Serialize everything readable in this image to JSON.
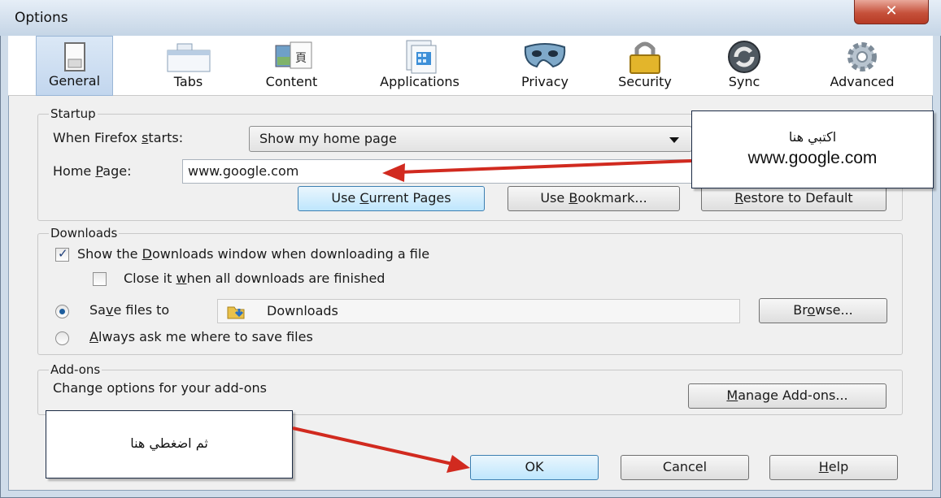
{
  "window": {
    "title": "Options",
    "close_glyph": "✕"
  },
  "toolbar": {
    "tabs": [
      {
        "label": "General",
        "icon": "switch-icon",
        "selected": true
      },
      {
        "label": "Tabs",
        "icon": "tabs-icon"
      },
      {
        "label": "Content",
        "icon": "content-icon"
      },
      {
        "label": "Applications",
        "icon": "applications-icon"
      },
      {
        "label": "Privacy",
        "icon": "mask-icon"
      },
      {
        "label": "Security",
        "icon": "padlock-icon"
      },
      {
        "label": "Sync",
        "icon": "sync-icon"
      },
      {
        "label": "Advanced",
        "icon": "gear-icon"
      }
    ]
  },
  "startup": {
    "group_label": "Startup",
    "when_starts_label": "When Firefox starts:",
    "when_starts_value": "Show my home page",
    "home_page_label": "Home Page:",
    "home_page_value": "www.google.com",
    "use_current_pages": "Use Current Pages",
    "use_bookmark": "Use Bookmark...",
    "restore_default": "Restore to Default"
  },
  "downloads": {
    "group_label": "Downloads",
    "show_window_label": "Show the Downloads window when downloading a file",
    "show_window_checked": true,
    "close_it_label": "Close it when all downloads are finished",
    "close_it_checked": false,
    "save_files_label": "Save files to",
    "save_folder": "Downloads",
    "browse": "Browse...",
    "always_ask_label": "Always ask me where to save files"
  },
  "addons": {
    "group_label": "Add-ons",
    "description": "Change options for your add-ons",
    "manage": "Manage Add-ons..."
  },
  "footer": {
    "ok": "OK",
    "cancel": "Cancel",
    "help": "Help"
  },
  "annotations": {
    "homepage_callout_line1": "اكتبي هنا",
    "homepage_callout_line2": "www.google.com",
    "ok_callout": "ثم اضغطي هنا",
    "arrow_color": "#d12a1f"
  }
}
